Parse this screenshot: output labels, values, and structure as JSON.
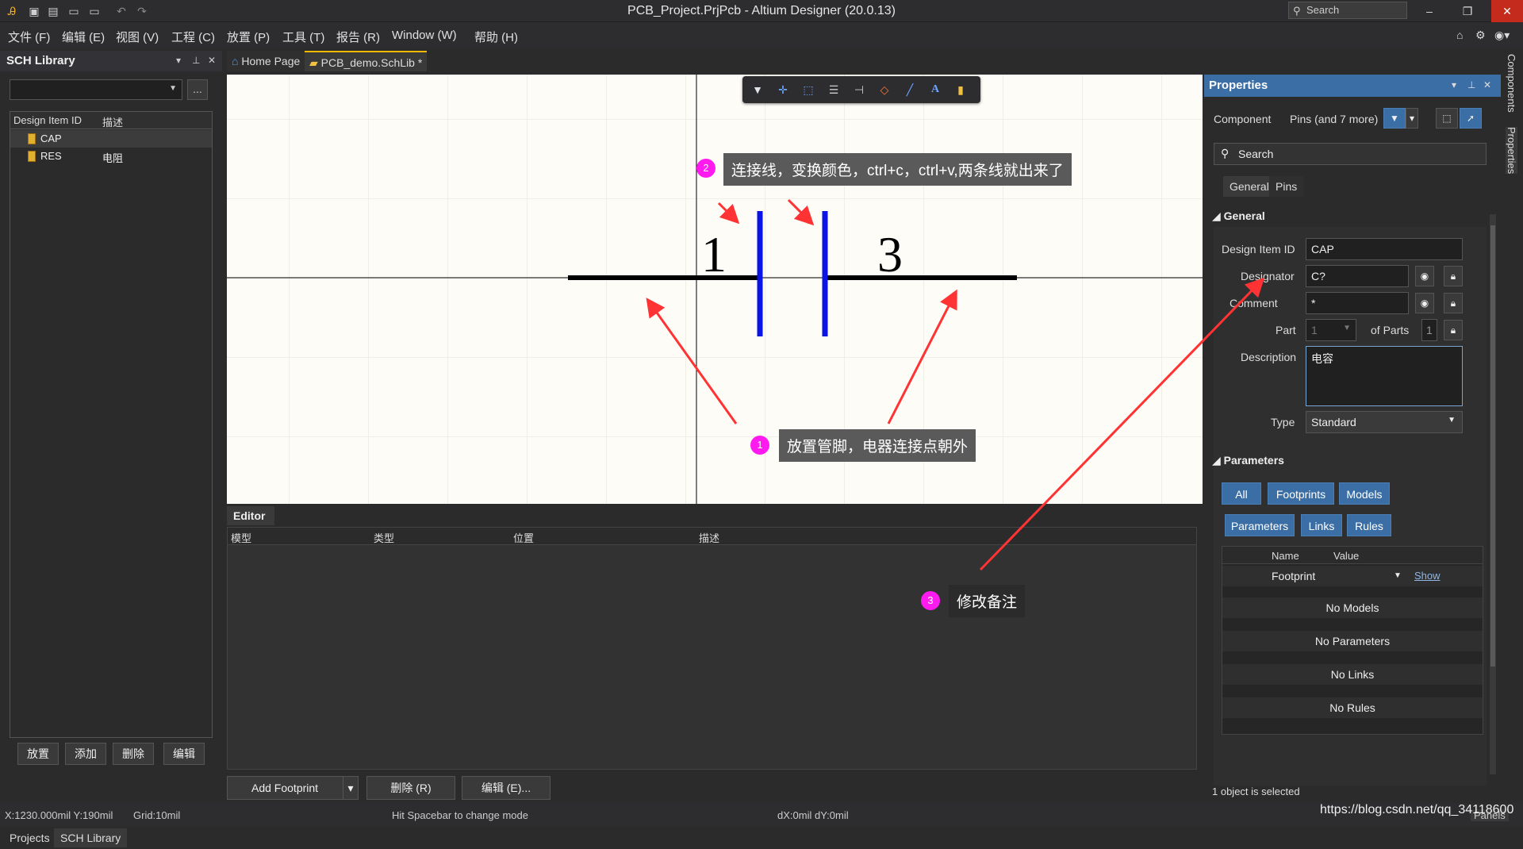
{
  "app": {
    "title": "PCB_Project.PrjPcb - Altium Designer (20.0.13)",
    "search_placeholder": "Search"
  },
  "menu": [
    "文件 (F)",
    "编辑 (E)",
    "视图 (V)",
    "工程 (C)",
    "放置 (P)",
    "工具 (T)",
    "报告 (R)",
    "Window (W)",
    "帮助 (H)"
  ],
  "left_panel": {
    "title": "SCH Library",
    "dots": "...",
    "columns": [
      "Design Item ID",
      "描述"
    ],
    "rows": [
      {
        "id": "CAP",
        "desc": ""
      },
      {
        "id": "RES",
        "desc": "电阻"
      }
    ],
    "buttons": [
      "放置",
      "添加",
      "删除",
      "编辑"
    ],
    "tabs": [
      "Projects",
      "SCH Library"
    ]
  },
  "doc_tabs": [
    "Home Page",
    "PCB_demo.SchLib *"
  ],
  "canvas": {
    "pin_left_number": "1",
    "pin_right_number": "3",
    "plate_color": "#0a14e6",
    "wire_color": "#000000"
  },
  "editor": {
    "tab": "Editor",
    "columns": [
      "模型",
      "类型",
      "位置",
      "描述"
    ],
    "buttons": [
      "Add Footprint",
      "删除 (R)",
      "编辑 (E)..."
    ]
  },
  "properties": {
    "title": "Properties",
    "component_label": "Component",
    "filter_text": "Pins (and 7 more)",
    "search": "Search",
    "tabs": [
      "General",
      "Pins"
    ],
    "general_section": "General",
    "design_item_id_label": "Design Item ID",
    "design_item_id": "CAP",
    "designator_label": "Designator",
    "designator": "C?",
    "comment_label": "Comment",
    "comment": "*",
    "part_label": "Part",
    "part_value": "1",
    "of_parts_label": "of Parts",
    "of_parts": "1",
    "description_label": "Description",
    "description": "电容",
    "type_label": "Type",
    "type": "Standard",
    "parameters_section": "Parameters",
    "param_tags": [
      "All",
      "Footprints",
      "Models",
      "Parameters",
      "Links",
      "Rules"
    ],
    "param_columns": [
      "Name",
      "Value"
    ],
    "footprint_row": {
      "name": "Footprint",
      "action": "Show"
    },
    "empty_rows": [
      "No Models",
      "No Parameters",
      "No Links",
      "No Rules"
    ],
    "status": "1 object is selected"
  },
  "right_rail": [
    "Components",
    "Properties"
  ],
  "status_bar": {
    "coords": "X:1230.000mil Y:190mil",
    "grid": "Grid:10mil",
    "hint": "Hit Spacebar to change mode",
    "delta": "dX:0mil dY:0mil",
    "panels": "Panels"
  },
  "watermark": "https://blog.csdn.net/qq_34118600",
  "annotations": [
    {
      "num": "1",
      "text": "放置管脚，电器连接点朝外"
    },
    {
      "num": "2",
      "text": "连接线，变换颜色，ctrl+c，ctrl+v,两条线就出来了"
    },
    {
      "num": "3",
      "text": "修改备注"
    }
  ],
  "colors": {
    "accent": "#3a6ea5",
    "badge": "#ff1aef",
    "arrow": "#ff3333",
    "close": "#c42b1c"
  }
}
